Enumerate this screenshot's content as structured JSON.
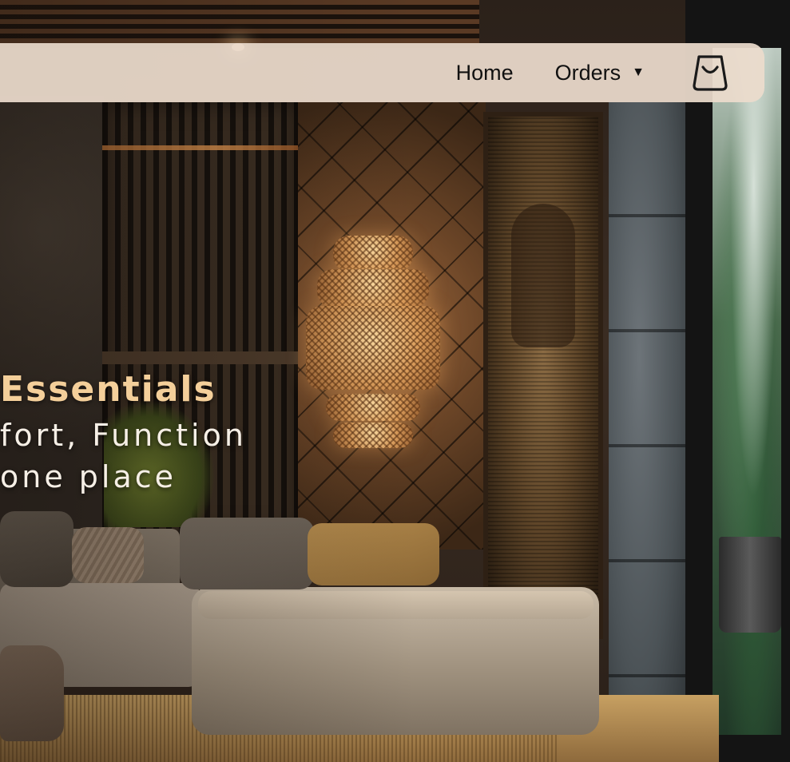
{
  "nav": {
    "home_label": "Home",
    "orders_label": "Orders",
    "orders_caret": "▼",
    "cart_icon": "shopping-bag-icon"
  },
  "hero": {
    "title": "Essentials",
    "subtitle_line1": "fort, Function",
    "subtitle_line2": "one place"
  },
  "colors": {
    "nav_background": "#ecdccc",
    "title_accent": "#f4cf9a",
    "subtitle_text": "#f6efe6",
    "nav_text": "#111111"
  }
}
